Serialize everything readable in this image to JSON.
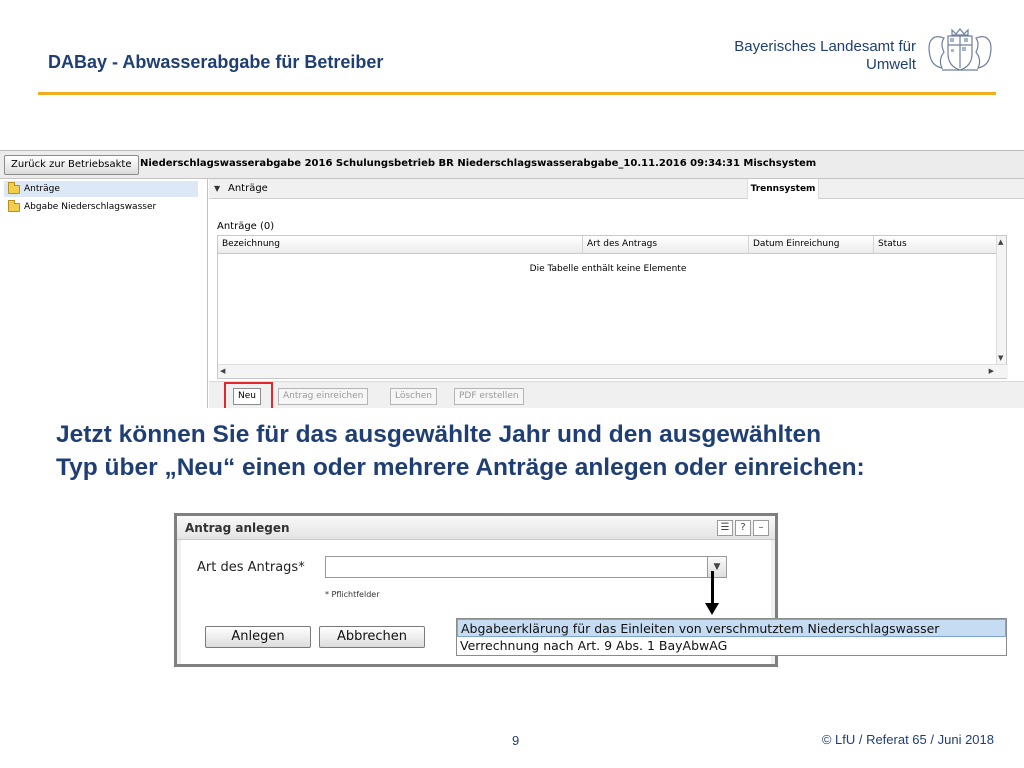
{
  "slide": {
    "title": "DABay - Abwasserabgabe für Betreiber",
    "agency_line1": "Bayerisches Landesamt für",
    "agency_line2": "Umwelt",
    "explanation_line1": "Jetzt können Sie für das ausgewählte Jahr und den ausgewählten",
    "explanation_line2": "Typ über „Neu“ einen oder mehrere Anträge anlegen oder einreichen:",
    "page_number": "9",
    "copyright": "© LfU / Referat 65 / Juni 2018",
    "accent_color": "#f0ac1c",
    "text_color": "#1f3f74"
  },
  "app": {
    "back_button": "Zurück zur Betriebsakte",
    "context": "Niederschlagswasserabgabe 2016 Schulungsbetrieb BR Niederschlagswasserabgabe_10.11.2016 09:34:31 Mischsystem",
    "tree": [
      {
        "label": "Anträge",
        "icon": "folder-icon",
        "selected": true
      },
      {
        "label": "Abgabe Niederschlagswasser",
        "icon": "folder-icon",
        "selected": false
      }
    ],
    "panel_title": "Anträge",
    "panel_tab": "Trennsystem",
    "count_label": "Anträge (0)",
    "columns": [
      "Bezeichnung",
      "Art des Antrags",
      "Datum Einreichung",
      "Status"
    ],
    "empty_message": "Die Tabelle enthält keine Elemente",
    "buttons": {
      "new": "Neu",
      "submit": "Antrag einreichen",
      "delete": "Löschen",
      "pdf": "PDF erstellen"
    }
  },
  "dialog": {
    "title": "Antrag anlegen",
    "field_label": "Art des Antrags*",
    "field_value": "",
    "required_note": "* Pflichtfelder",
    "create_button": "Anlegen",
    "cancel_button": "Abbrechen",
    "icons": [
      "comment-icon",
      "help-icon",
      "minimize-icon"
    ],
    "options": [
      {
        "label": "Abgabeerklärung für das Einleiten von verschmutztem Niederschlagswasser",
        "highlighted": true
      },
      {
        "label": "Verrechnung nach Art. 9 Abs. 1 BayAbwAG",
        "highlighted": false
      }
    ]
  }
}
